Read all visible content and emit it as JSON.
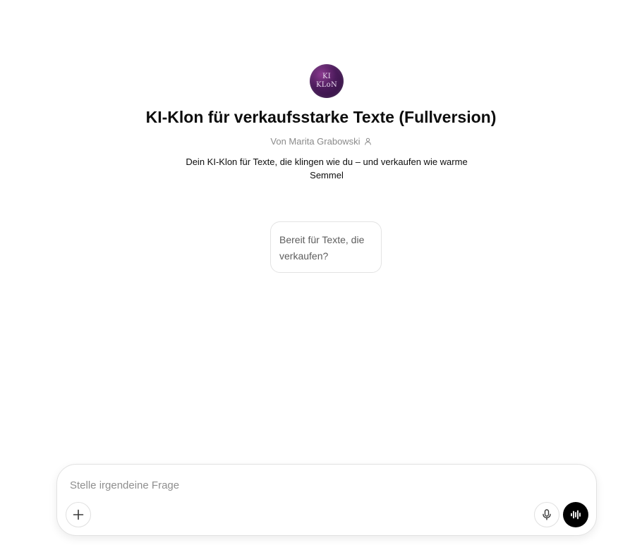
{
  "gpt": {
    "avatar_line1": "KI",
    "avatar_line2": "KLoN",
    "title": "KI-Klon für verkaufsstarke Texte (Fullversion)",
    "author": "Von Marita Grabowski",
    "description": "Dein KI-Klon für Texte, die klingen wie du – und verkaufen wie warme Semmel"
  },
  "starters": [
    {
      "label": "Bereit für Texte, die verkaufen?"
    }
  ],
  "composer": {
    "placeholder": "Stelle irgendeine Frage",
    "value": "",
    "plus_icon": "plus-icon",
    "mic_icon": "microphone-icon",
    "voice_icon": "voice-waveform-icon"
  },
  "colors": {
    "voice_button_bg": "#000000",
    "muted_text": "#8a8a8a",
    "border": "#e2e2e2"
  }
}
